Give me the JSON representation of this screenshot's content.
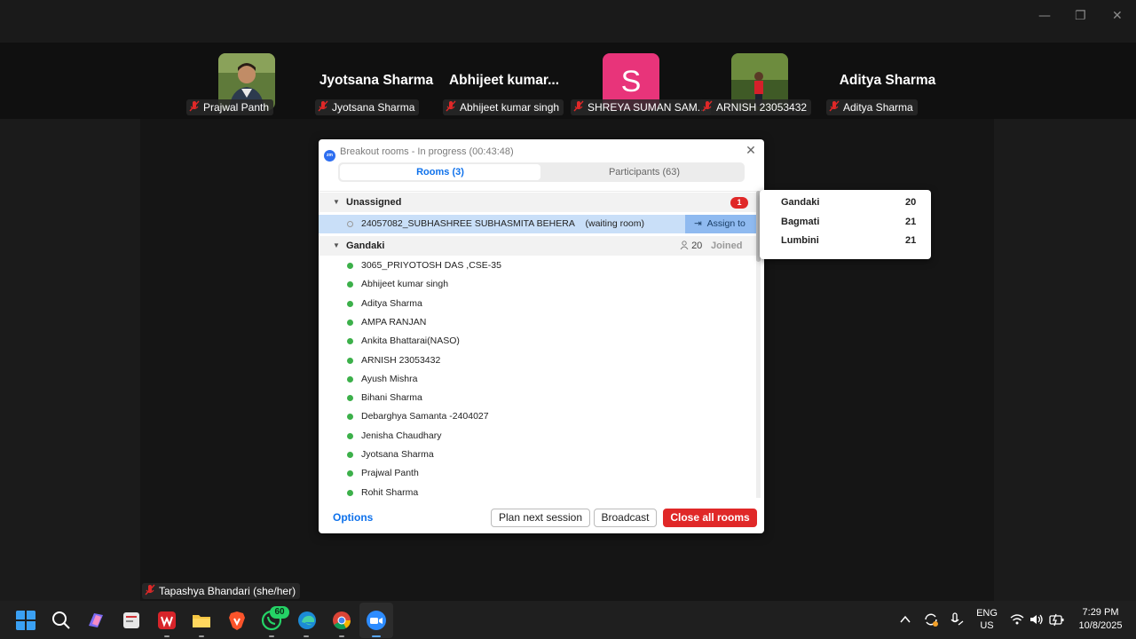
{
  "window": {
    "minimize": "—",
    "restore": "❐",
    "close": "✕"
  },
  "participants_strip": [
    {
      "tag": "Prajwal Panth",
      "display": "photo"
    },
    {
      "tag": "Jyotsana Sharma",
      "display": "name",
      "big_name": "Jyotsana Sharma"
    },
    {
      "tag": "Abhijeet kumar singh",
      "display": "name",
      "big_name": "Abhijeet  kumar..."
    },
    {
      "tag": "SHREYA SUMAN SAM...",
      "display": "letter",
      "letter": "S",
      "color": "#e8347a"
    },
    {
      "tag": "ARNISH 23053432",
      "display": "photo"
    },
    {
      "tag": "Aditya Sharma",
      "display": "name",
      "big_name": "Aditya Sharma"
    }
  ],
  "speaker_tag": "Tapashya Bhandari (she/her)",
  "dialog": {
    "logo_text": "zm",
    "title": "Breakout rooms - In progress (00:43:48)",
    "close": "✕",
    "tabs": {
      "rooms": "Rooms (3)",
      "participants": "Participants (63)"
    },
    "unassigned": {
      "label": "Unassigned",
      "badge": "1",
      "participant": "24057082_SUBHASHREE SUBHASMITA BEHERA",
      "status": "(waiting room)",
      "assign_label": "Assign to"
    },
    "room": {
      "label": "Gandaki",
      "count": "20",
      "status": "Joined",
      "members": [
        "3065_PRIYOTOSH DAS ,CSE-35",
        "Abhijeet kumar singh",
        "Aditya Sharma",
        "AMPA RANJAN",
        "Ankita Bhattarai(NASO)",
        "ARNISH 23053432",
        "Ayush Mishra",
        "Bihani Sharma",
        "Debarghya Samanta -2404027",
        "Jenisha Chaudhary",
        "Jyotsana Sharma",
        "Prajwal Panth",
        "Rohit Sharma"
      ]
    },
    "footer": {
      "options": "Options",
      "plan": "Plan next session",
      "broadcast": "Broadcast",
      "close_all": "Close all rooms"
    }
  },
  "assign_menu": [
    {
      "name": "Gandaki",
      "count": "20"
    },
    {
      "name": "Bagmati",
      "count": "21"
    },
    {
      "name": "Lumbini",
      "count": "21"
    }
  ],
  "taskbar": {
    "whatsapp_badge": "60",
    "lang_line1": "ENG",
    "lang_line2": "US",
    "time": "7:29 PM",
    "date": "10/8/2025"
  },
  "colors": {
    "accent": "#0e71eb",
    "danger": "#e02828",
    "online": "#3cb04a"
  }
}
